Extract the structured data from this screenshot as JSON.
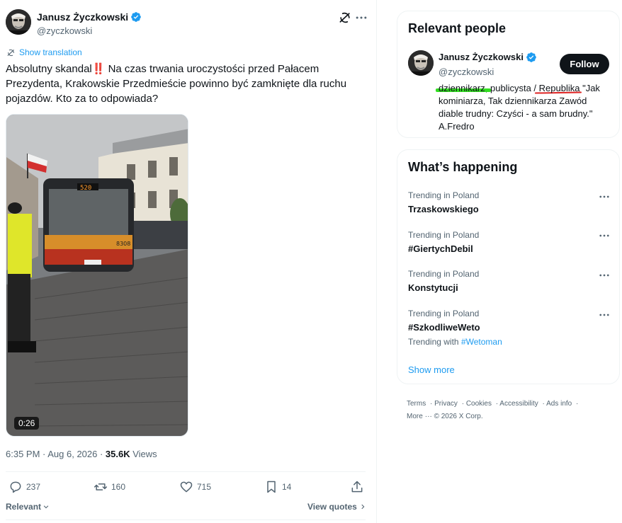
{
  "tweet": {
    "author_name": "Janusz Życzkowski",
    "author_handle": "@zyczkowski",
    "show_translation": "Show translation",
    "text": "Absolutny skandal‼️ Na czas trwania uroczystości przed Pałacem Prezydenta, Krakowskie Przedmieście powinno być zamknięte dla ruchu pojazdów. Kto za to odpowiada?",
    "video_duration": "0:26",
    "bus_route": "520",
    "bus_number": "8308",
    "timestamp": "6:35 PM · Aug 6, 2026 · ",
    "views_count": "35.6K",
    "views_label": " Views",
    "actions": {
      "replies": "237",
      "reposts": "160",
      "likes": "715",
      "bookmarks": "14"
    },
    "sort_label": "Relevant",
    "view_quotes": "View quotes"
  },
  "relevant_people": {
    "title": "Relevant people",
    "person": {
      "name": "Janusz Życzkowski",
      "handle": "@zyczkowski",
      "follow_label": "Follow",
      "bio_part1": "dziennikarz",
      "bio_part2": ", publicysta / ",
      "bio_part3": "Republika",
      "bio_part4": " \"Jak kominiarza, Tak dziennikarza Zawód diable trudny: Czyści - a sam brudny.\" A.Fredro"
    }
  },
  "whats_happening": {
    "title": "What’s happening",
    "trends": [
      {
        "category": "Trending in Poland",
        "name": "Trzaskowskiego"
      },
      {
        "category": "Trending in Poland",
        "name": "#GiertychDebil"
      },
      {
        "category": "Trending in Poland",
        "name": "Konstytucji"
      },
      {
        "category": "Trending in Poland",
        "name": "#SzkodliweWeto",
        "with_label": "Trending with ",
        "with_tag": "#Wetoman"
      }
    ],
    "show_more": "Show more"
  },
  "footer": {
    "links": [
      "Terms",
      "Privacy",
      "Cookies",
      "Accessibility",
      "Ads info"
    ],
    "more": "More",
    "copyright": "© 2026 X Corp."
  },
  "colors": {
    "accent": "#1d9bf0",
    "text": "#0f1419",
    "muted": "#536471",
    "highlight_green": "#33dd22",
    "highlight_red": "#dd2222"
  }
}
